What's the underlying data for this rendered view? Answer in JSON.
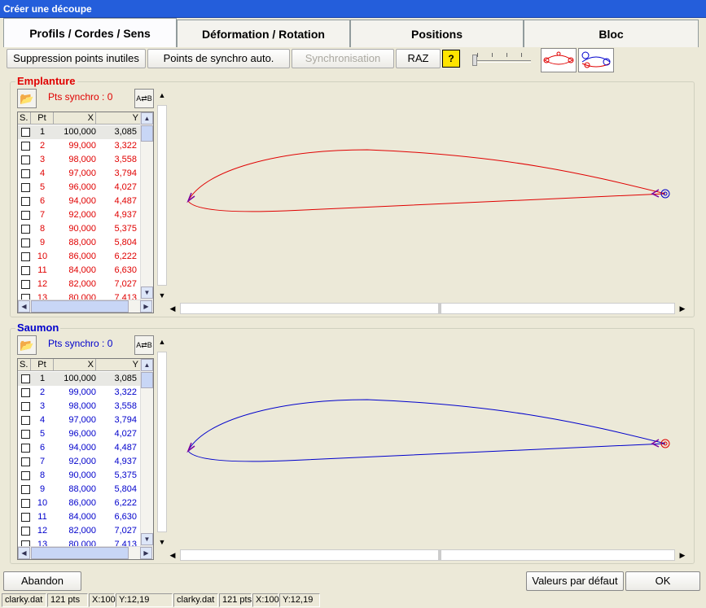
{
  "window": {
    "title": "Créer une découpe"
  },
  "tabs": [
    {
      "label": "Profils / Cordes / Sens"
    },
    {
      "label": "Déformation / Rotation"
    },
    {
      "label": "Positions"
    },
    {
      "label": "Bloc"
    }
  ],
  "toolbar": {
    "remove_points": "Suppression points inutiles",
    "auto_sync": "Points de synchro auto.",
    "sync": "Synchronisation",
    "raz": "RAZ",
    "help": "?"
  },
  "colors": {
    "root": "#e00000",
    "tip": "#0000cc",
    "accent": "#245edb"
  },
  "columns": {
    "s": "S.",
    "pt": "Pt",
    "x": "X",
    "y": "Y"
  },
  "points": [
    {
      "pt": "1",
      "x": "100,000",
      "y": "3,085"
    },
    {
      "pt": "2",
      "x": "99,000",
      "y": "3,322"
    },
    {
      "pt": "3",
      "x": "98,000",
      "y": "3,558"
    },
    {
      "pt": "4",
      "x": "97,000",
      "y": "3,794"
    },
    {
      "pt": "5",
      "x": "96,000",
      "y": "4,027"
    },
    {
      "pt": "6",
      "x": "94,000",
      "y": "4,487"
    },
    {
      "pt": "7",
      "x": "92,000",
      "y": "4,937"
    },
    {
      "pt": "8",
      "x": "90,000",
      "y": "5,375"
    },
    {
      "pt": "9",
      "x": "88,000",
      "y": "5,804"
    },
    {
      "pt": "10",
      "x": "86,000",
      "y": "6,222"
    },
    {
      "pt": "11",
      "x": "84,000",
      "y": "6,630"
    },
    {
      "pt": "12",
      "x": "82,000",
      "y": "7,027"
    },
    {
      "pt": "13",
      "x": "80,000",
      "y": "7,413"
    }
  ],
  "root": {
    "title": "Emplanture",
    "sync_label": "Pts synchro : 0"
  },
  "tip": {
    "title": "Saumon",
    "sync_label": "Pts synchro : 0"
  },
  "buttons": {
    "abort": "Abandon",
    "defaults": "Valeurs par défaut",
    "ok": "OK"
  },
  "status": {
    "left": [
      "clarky.dat",
      "121 pts",
      "X:100",
      "Y:12,19"
    ],
    "right": [
      "clarky.dat",
      "121 pts",
      "X:100",
      "Y:12,19"
    ]
  }
}
